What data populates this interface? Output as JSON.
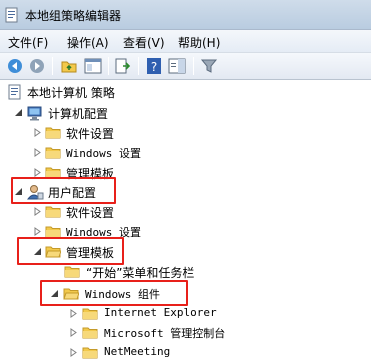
{
  "window": {
    "title": "本地组策略编辑器"
  },
  "menu": {
    "items": [
      {
        "label": "文件(F)"
      },
      {
        "label": "操作(A)"
      },
      {
        "label": "查看(V)"
      },
      {
        "label": "帮助(H)"
      }
    ]
  },
  "toolbar": {
    "buttons": [
      "back-arrow-icon",
      "forward-arrow-icon",
      "up-folder-icon",
      "show-hide-tree-icon",
      "export-list-icon",
      "help-icon",
      "properties-pane-icon",
      "filter-icon"
    ]
  },
  "tree": {
    "root": "本地计算机 策略",
    "computer_config": "计算机配置",
    "computer_software": "软件设置",
    "computer_windows": "Windows 设置",
    "computer_admin": "管理模板",
    "user_config": "用户配置",
    "user_software": "软件设置",
    "user_windows": "Windows 设置",
    "user_admin": "管理模板",
    "start_menu": "“开始”菜单和任务栏",
    "windows_components": "Windows 组件",
    "internet_explorer": "Internet Explorer",
    "mmc": "Microsoft 管理控制台",
    "netmeeting": "NetMeeting"
  },
  "colors": {
    "highlight": "#e8201a",
    "folder": "#f2c94c",
    "titlebar": "#c4d4e6"
  }
}
